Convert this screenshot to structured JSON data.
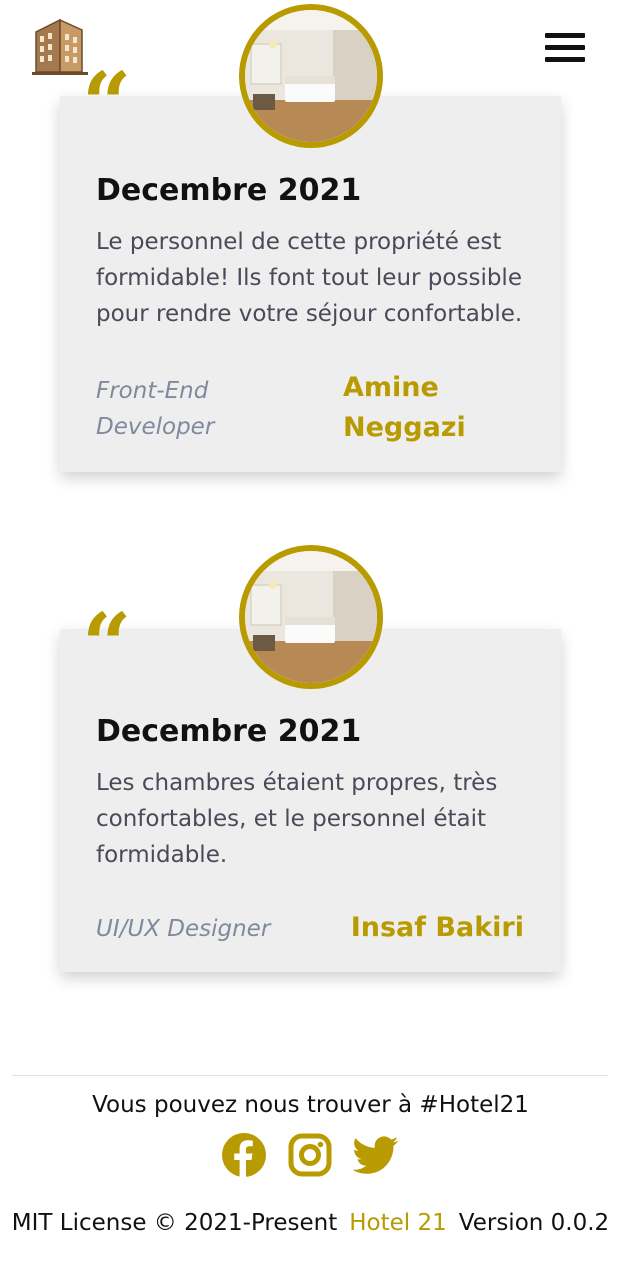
{
  "header": {
    "logo_icon": "building-icon",
    "menu_icon": "hamburger-menu-icon"
  },
  "testimonials": [
    {
      "date": "Decembre 2021",
      "text": "Le personnel de cette propriété est formidable! Ils font tout leur possible pour rendre votre séjour confortable.",
      "role": "Front-End Developer",
      "author": "Amine Neggazi",
      "quote_mark": "“",
      "image_icon": "hotel-room-photo"
    },
    {
      "date": "Decembre 2021",
      "text": "Les chambres étaient propres, très confortables, et le personnel était formidable.",
      "role": "UI/UX Designer",
      "author": "Insaf Bakiri",
      "quote_mark": "“",
      "image_icon": "hotel-room-photo"
    }
  ],
  "footer": {
    "find_us": "Vous pouvez nous trouver à #Hotel21",
    "social": [
      "facebook-icon",
      "instagram-icon",
      "twitter-icon"
    ],
    "license": "MIT License © 2021-Present",
    "brand": "Hotel 21",
    "version": "Version 0.0.2"
  },
  "colors": {
    "accent": "#b89b00",
    "card_bg": "#eeeeee",
    "text": "#4a4a58",
    "role": "#7f8a9c"
  }
}
